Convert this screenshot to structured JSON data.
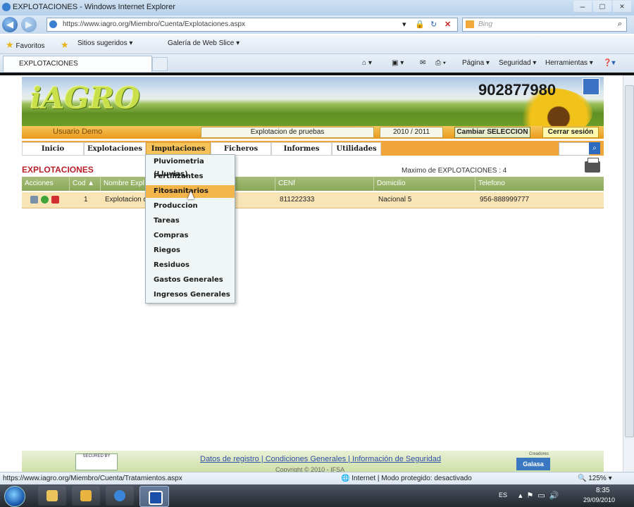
{
  "window": {
    "title": "EXPLOTACIONES - Windows Internet Explorer",
    "controls": [
      "–",
      "□",
      "×"
    ]
  },
  "address": {
    "url": "https://www.iagro.org/Miembro/Cuenta/Explotaciones.aspx",
    "search_placeholder": "Bing"
  },
  "favorites": {
    "label": "Favoritos",
    "suggested": "Sitios sugeridos ▾",
    "gallery": "Galería de Web Slice ▾"
  },
  "tab": {
    "title": "EXPLOTACIONES"
  },
  "commands": {
    "page": "Página ▾",
    "security": "Seguridad ▾",
    "tools": "Herramientas ▾"
  },
  "banner": {
    "logo": "iAGRO",
    "phone": "902877980"
  },
  "userbar": {
    "user": "Usuario Demo",
    "farm": "Explotacion de pruebas",
    "year": "2010 / 2011",
    "change": "Cambiar SELECCION",
    "logout": "Cerrar sesión"
  },
  "menu": {
    "items": [
      "Inicio",
      "Explotaciones",
      "Imputaciones",
      "Ficheros",
      "Informes",
      "Utilidades"
    ],
    "active": "Imputaciones"
  },
  "dropdown": {
    "items": [
      "Pluviometria (Lluvias)",
      "Fertilizantes",
      "Fitosanitarios",
      "Produccion",
      "Tareas",
      "Compras",
      "Riegos",
      "Residuos",
      "Gastos Generales",
      "Ingresos Generales"
    ],
    "hovered": "Fitosanitarios"
  },
  "content": {
    "title": "EXPLOTACIONES",
    "max": "Maximo de EXPLOTACIONES : 4"
  },
  "grid": {
    "columns": [
      "Acciones",
      "Cod ▲",
      "Nombre Expl",
      "CENf",
      "Domicilio",
      "Telefono"
    ],
    "rows": [
      {
        "cod": "1",
        "nombre": "Explotacion d",
        "cenf": "811222333",
        "domicilio": "Nacional 5",
        "telefono": "956-888999777"
      }
    ]
  },
  "footer": {
    "links": "Datos de registro | Condiciones Generales | Información de Seguridad",
    "copyright": "Copyright © 2010 - IFSA",
    "badge": "SECURED BY",
    "brand": "Galasa",
    "brand_label": "Creadores"
  },
  "status": {
    "url": "https://www.iagro.org/Miembro/Cuenta/Tratamientos.aspx",
    "zone": "Internet | Modo protegido: desactivado",
    "zoom": "125% ▾"
  },
  "taskbar": {
    "lang": "ES",
    "time": "8:35",
    "date": "29/09/2010"
  },
  "colors": {
    "accent": "#f0a63a",
    "title_red": "#b8202a",
    "grid_header": "#8aa756",
    "row_bg": "#f9e4b6"
  }
}
